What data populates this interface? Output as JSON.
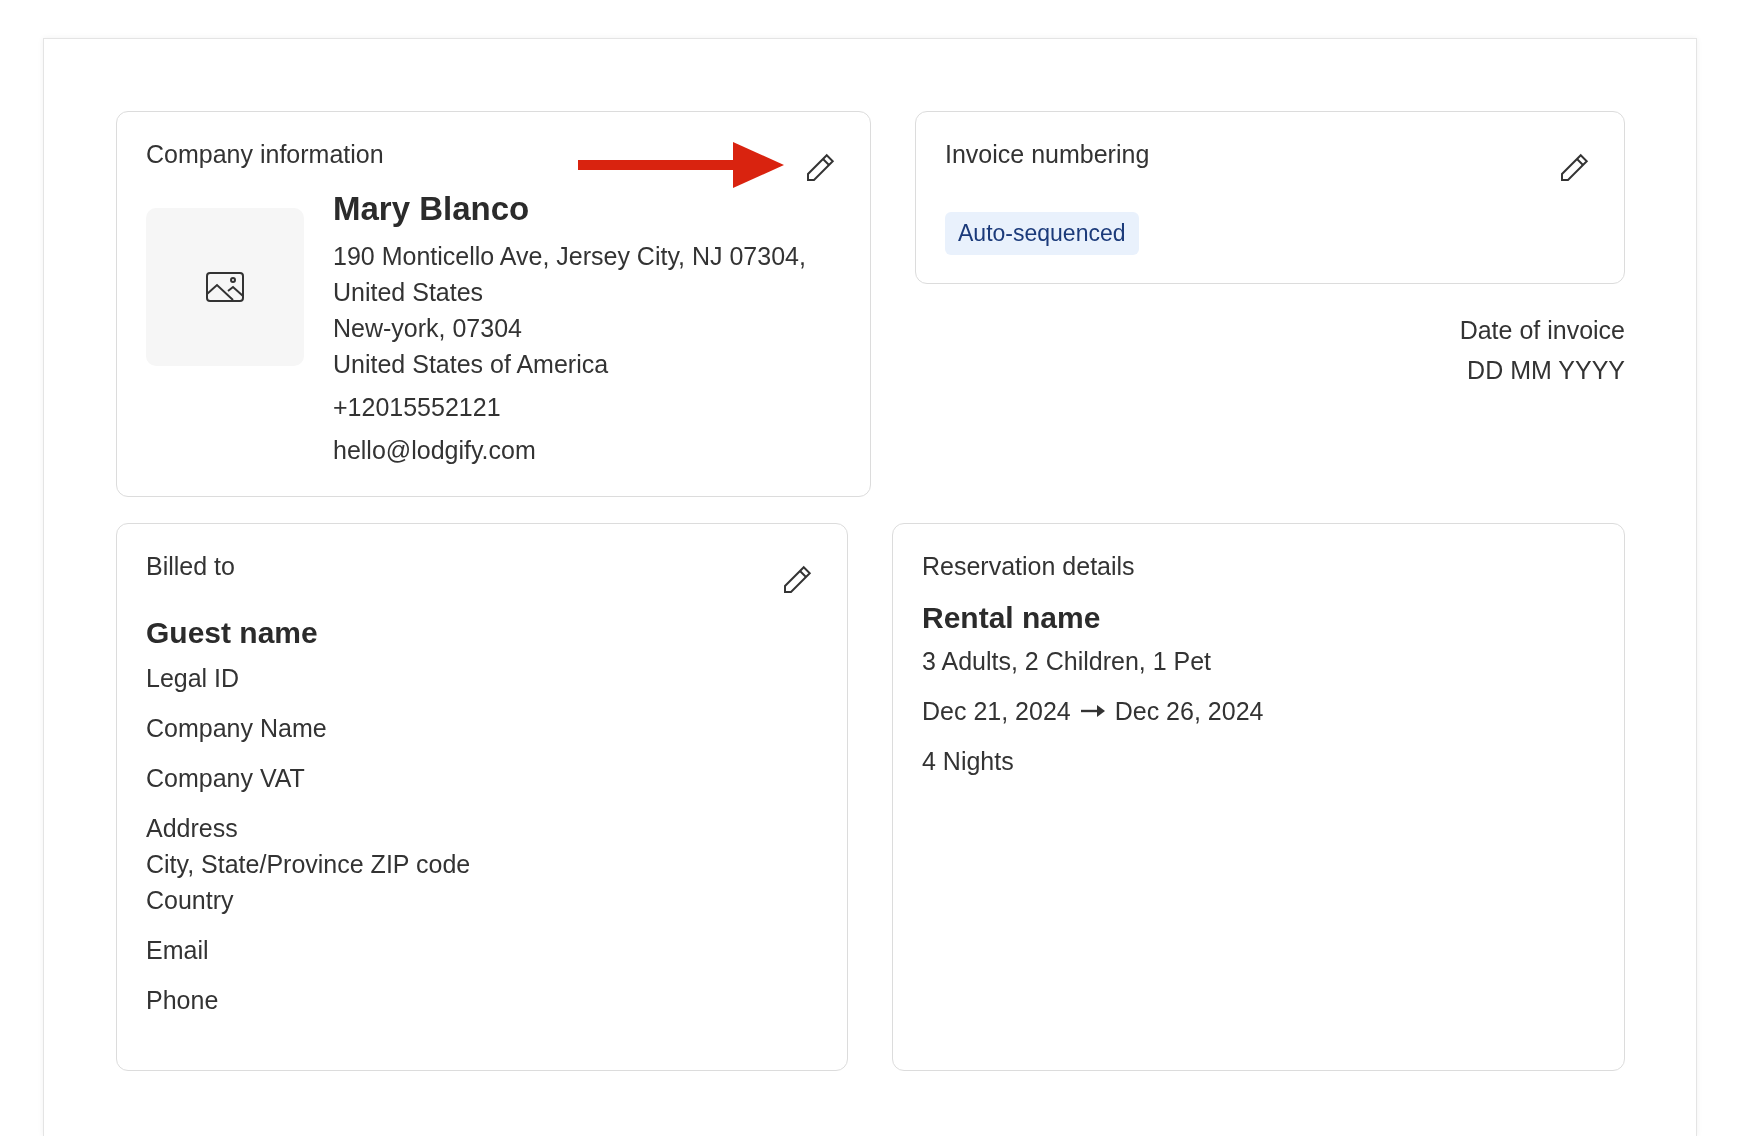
{
  "company": {
    "title": "Company information",
    "name": "Mary Blanco",
    "address_lines": [
      "190 Monticello Ave, Jersey City, NJ 07304,",
      "United States",
      "New-york, 07304",
      "United States of America"
    ],
    "phone": "+12015552121",
    "email": "hello@lodgify.com"
  },
  "invoice_numbering": {
    "title": "Invoice numbering",
    "badge": "Auto-sequenced"
  },
  "date_of_invoice": {
    "label": "Date of invoice",
    "value": "DD MM YYYY"
  },
  "billed_to": {
    "title": "Billed to",
    "name": "Guest name",
    "groups": [
      [
        "Legal ID"
      ],
      [
        "Company Name"
      ],
      [
        "Company VAT"
      ],
      [
        "Address",
        "City, State/Province ZIP code",
        "Country"
      ],
      [
        "Email"
      ],
      [
        "Phone"
      ]
    ]
  },
  "reservation": {
    "title": "Reservation details",
    "name": "Rental name",
    "guests": "3 Adults, 2 Children, 1 Pet",
    "check_in": "Dec 21, 2024",
    "check_out": "Dec 26, 2024",
    "nights": "4 Nights"
  }
}
